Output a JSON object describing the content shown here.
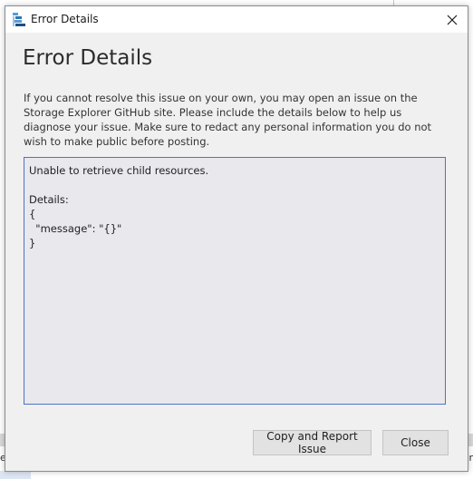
{
  "window": {
    "title": "Error Details"
  },
  "dialog": {
    "heading": "Error Details",
    "description": "If you cannot resolve this issue on your own, you may open an issue on the Storage Explorer GitHub site. Please include the details below to help us diagnose your issue. Make sure to redact any personal information you do not wish to make public before posting.",
    "details_text": "Unable to retrieve child resources.\n\nDetails:\n{\n  \"message\": \"{}\"\n}",
    "buttons": {
      "copy_report_label": "Copy and Report Issue",
      "close_label": "Close"
    }
  },
  "background": {
    "left_text": "e",
    "right_text": "r"
  },
  "icons": {
    "app": "storage-explorer-icon",
    "close": "close-icon"
  },
  "colors": {
    "details_border": "#4f73c2",
    "details_background": "#e8e8ed",
    "dialog_background": "#f0f0f0"
  }
}
